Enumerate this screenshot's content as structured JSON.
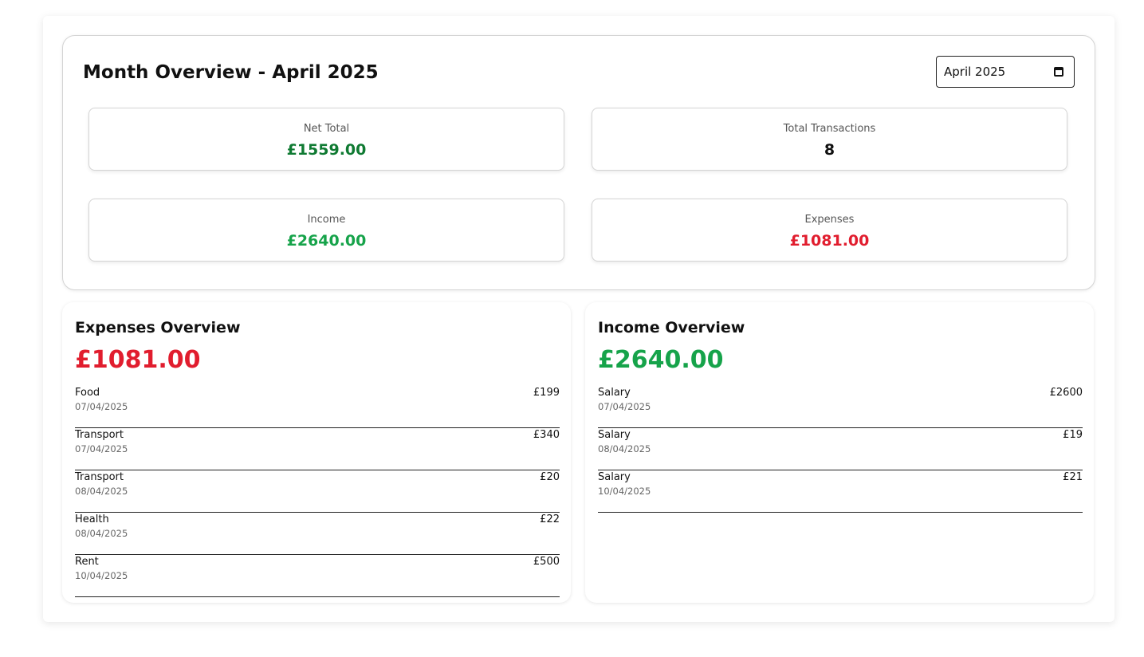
{
  "month_overview": {
    "title": "Month Overview - April 2025",
    "picker": {
      "value": "April  2025",
      "icon": "calendar-icon"
    },
    "stats": {
      "net_total": {
        "label": "Net Total",
        "value": "£1559.00"
      },
      "total_transactions": {
        "label": "Total Transactions",
        "value": "8"
      },
      "income": {
        "label": "Income",
        "value": "£2640.00"
      },
      "expenses": {
        "label": "Expenses",
        "value": "£1081.00"
      }
    }
  },
  "expenses_overview": {
    "title": "Expenses Overview",
    "total": "£1081.00",
    "items": [
      {
        "category": "Food",
        "date": "07/04/2025",
        "amount": "£199"
      },
      {
        "category": "Transport",
        "date": "07/04/2025",
        "amount": "£340"
      },
      {
        "category": "Transport",
        "date": "08/04/2025",
        "amount": "£20"
      },
      {
        "category": "Health",
        "date": "08/04/2025",
        "amount": "£22"
      },
      {
        "category": "Rent",
        "date": "10/04/2025",
        "amount": "£500"
      }
    ]
  },
  "income_overview": {
    "title": "Income Overview",
    "total": "£2640.00",
    "items": [
      {
        "category": "Salary",
        "date": "07/04/2025",
        "amount": "£2600"
      },
      {
        "category": "Salary",
        "date": "08/04/2025",
        "amount": "£19"
      },
      {
        "category": "Salary",
        "date": "10/04/2025",
        "amount": "£21"
      }
    ]
  },
  "colors": {
    "net_total": "#0f7a32",
    "income": "#16a34a",
    "expenses": "#e11d2e"
  }
}
